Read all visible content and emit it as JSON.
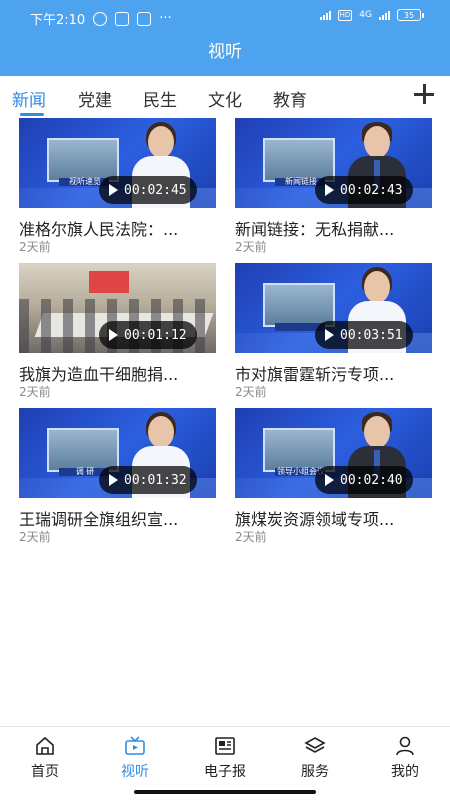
{
  "status": {
    "time": "下午2:10",
    "network": "4G",
    "battery": "35"
  },
  "header": {
    "title": "视听"
  },
  "tabs": [
    "新闻",
    "党建",
    "民生",
    "文化",
    "教育"
  ],
  "videos": [
    {
      "duration": "00:02:45",
      "title": "准格尔旗人民法院：...",
      "time": "2天前",
      "thumb_text": "视听速览"
    },
    {
      "duration": "00:02:43",
      "title": "新闻链接：无私捐献...",
      "time": "2天前",
      "thumb_text": "新闻链接"
    },
    {
      "duration": "00:01:12",
      "title": "我旗为造血干细胞捐...",
      "time": "2天前"
    },
    {
      "duration": "00:03:51",
      "title": "市对旗雷霆斩污专项...",
      "time": "2天前"
    },
    {
      "duration": "00:01:32",
      "title": "王瑞调研全旗组织宣...",
      "time": "2天前",
      "thumb_text": "调 研"
    },
    {
      "duration": "00:02:40",
      "title": "旗煤炭资源领域专项...",
      "time": "2天前",
      "thumb_text": "领导小组会议"
    }
  ],
  "nav": [
    "首页",
    "视听",
    "电子报",
    "服务",
    "我的"
  ],
  "colors": {
    "accent": "#2f8de4",
    "header_bg": "#4ea3ee"
  }
}
